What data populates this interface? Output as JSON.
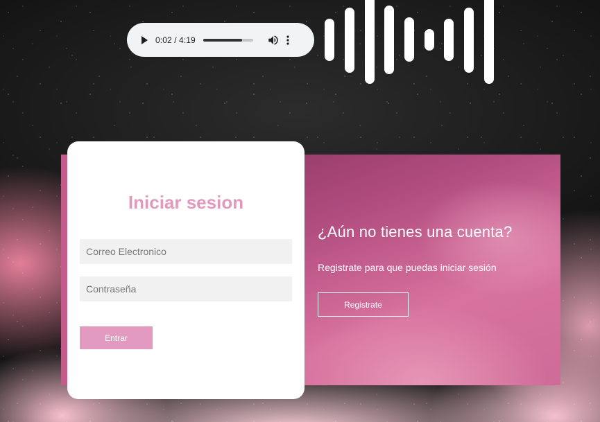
{
  "audio": {
    "time_display": "0:02 / 4:19",
    "progress": 0.78,
    "icons": [
      "play-icon",
      "volume-icon",
      "more-options-icon"
    ]
  },
  "waveform": {
    "bar_count": 9,
    "color": "#ffffff"
  },
  "login": {
    "title": "Iniciar sesion",
    "email_placeholder": "Correo Electronico",
    "password_placeholder": "Contraseña",
    "submit_label": "Entrar"
  },
  "signup": {
    "title": "¿Aún no tienes una cuenta?",
    "text": "Registrate para que puedas iniciar sesión",
    "button_label": "Registrate"
  },
  "colors": {
    "login_title": "#e398bd",
    "login_button": "#e29ac0",
    "panel": "#b24d80",
    "field_bg": "#f1f1f1"
  }
}
